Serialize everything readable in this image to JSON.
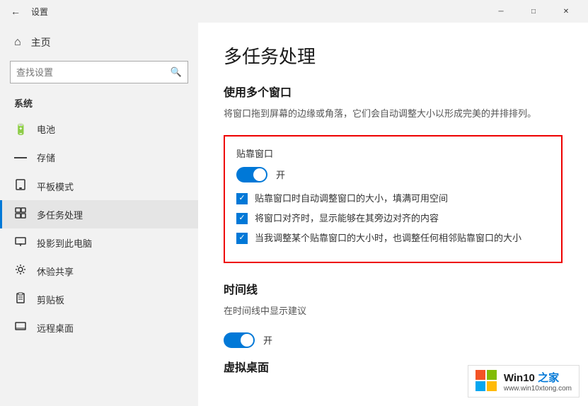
{
  "titlebar": {
    "back_icon": "←",
    "title": "设置",
    "minimize_icon": "─",
    "restore_icon": "□",
    "close_icon": "✕"
  },
  "sidebar": {
    "home_icon": "⌂",
    "home_label": "主页",
    "search_placeholder": "查找设置",
    "search_icon": "🔍",
    "section_title": "系统",
    "items": [
      {
        "id": "battery",
        "icon": "🔋",
        "label": "电池"
      },
      {
        "id": "storage",
        "icon": "─",
        "label": "存储"
      },
      {
        "id": "tablet",
        "icon": "⊡",
        "label": "平板模式"
      },
      {
        "id": "multitask",
        "icon": "⧉",
        "label": "多任务处理",
        "active": true
      },
      {
        "id": "project",
        "icon": "⊟",
        "label": "投影到此电脑"
      },
      {
        "id": "experience",
        "icon": "✿",
        "label": "休验共享"
      },
      {
        "id": "clipboard",
        "icon": "📋",
        "label": "剪贴板"
      },
      {
        "id": "remote",
        "icon": "⊞",
        "label": "远程桌面"
      }
    ]
  },
  "content": {
    "page_title": "多任务处理",
    "multi_window_section": "使用多个窗口",
    "multi_window_desc": "将窗口拖到屏幕的边缘或角落，它们会自动调整大小以形成完美的并排排列。",
    "snap_box": {
      "title": "贴靠窗口",
      "toggle_state_label": "开",
      "checkboxes": [
        {
          "id": "cb1",
          "label": "贴靠窗口时自动调整窗口的大小，填满可用空间"
        },
        {
          "id": "cb2",
          "label": "将窗口对齐时，显示能够在其旁边对齐的内容"
        },
        {
          "id": "cb3",
          "label": "当我调整某个贴靠窗口的大小时，也调整任何相邻贴靠窗口的大小"
        }
      ]
    },
    "timeline_section": "时间线",
    "timeline_desc": "在时间线中显示建议",
    "timeline_toggle_label": "开",
    "virtual_desktop_section": "虚拟桌面"
  },
  "watermark": {
    "line1_prefix": "Win10 ",
    "line1_highlight": "之家",
    "line2": "www.win10xtong.com"
  }
}
